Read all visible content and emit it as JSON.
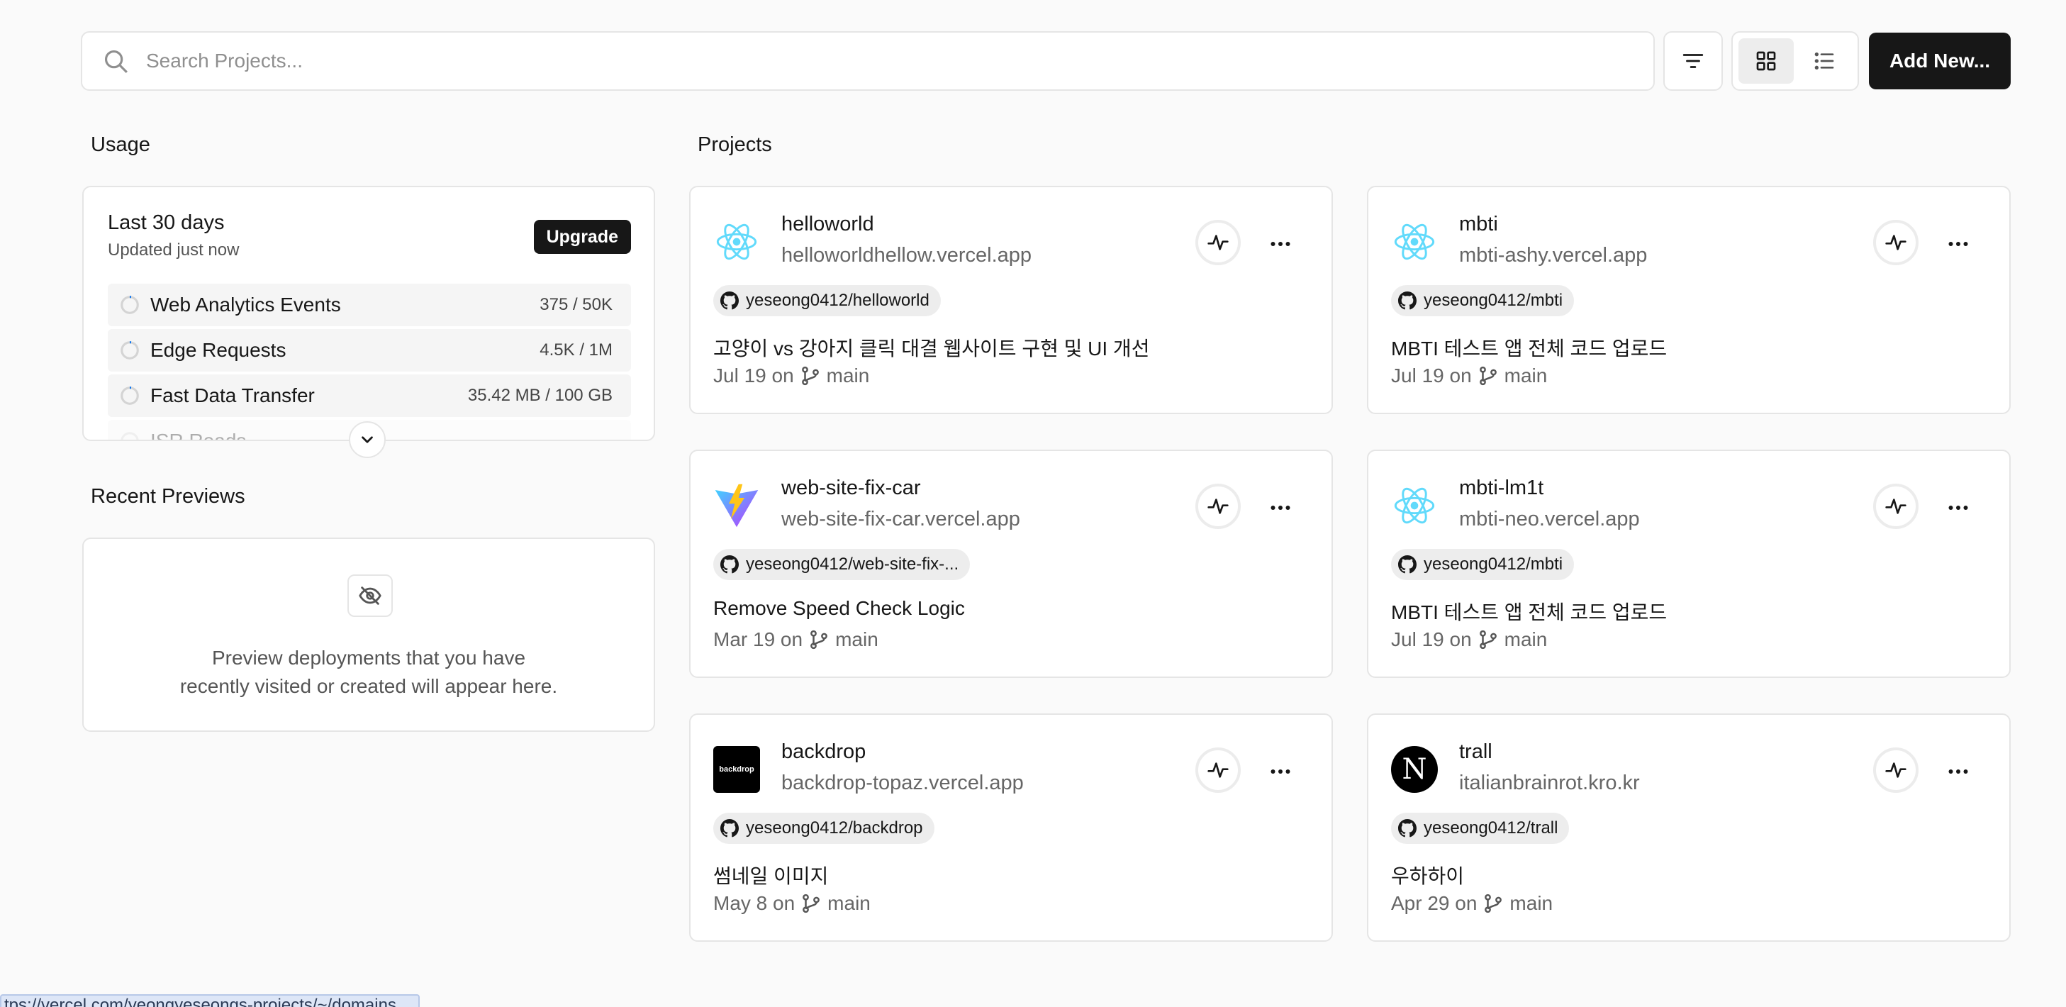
{
  "search": {
    "placeholder": "Search Projects..."
  },
  "toolbar": {
    "add_label": "Add New..."
  },
  "usage": {
    "title": "Usage",
    "period": "Last 30 days",
    "updated": "Updated just now",
    "upgrade_label": "Upgrade",
    "items": [
      {
        "name": "Web Analytics Events",
        "value": "375 / 50K"
      },
      {
        "name": "Edge Requests",
        "value": "4.5K / 1M"
      },
      {
        "name": "Fast Data Transfer",
        "value": "35.42 MB / 100 GB"
      },
      {
        "name": "ISR Reads",
        "value": ""
      }
    ]
  },
  "previews": {
    "title": "Recent Previews",
    "empty_line1": "Preview deployments that you have",
    "empty_line2": "recently visited or created will appear here."
  },
  "projects": {
    "title": "Projects",
    "items": [
      {
        "name": "helloworld",
        "url": "helloworldhellow.vercel.app",
        "repo": "yeseong0412/helloworld",
        "commit": "고양이 vs 강아지 클릭 대결 웹사이트 구현 및 UI 개선",
        "date": "Jul 19 on",
        "branch": "main",
        "logo": "react-icon"
      },
      {
        "name": "mbti",
        "url": "mbti-ashy.vercel.app",
        "repo": "yeseong0412/mbti",
        "commit": "MBTI 테스트 앱 전체 코드 업로드",
        "date": "Jul 19 on",
        "branch": "main",
        "logo": "react-icon"
      },
      {
        "name": "web-site-fix-car",
        "url": "web-site-fix-car.vercel.app",
        "repo": "yeseong0412/web-site-fix-...",
        "commit": "Remove Speed Check Logic",
        "date": "Mar 19 on",
        "branch": "main",
        "logo": "vite-icon"
      },
      {
        "name": "mbti-lm1t",
        "url": "mbti-neo.vercel.app",
        "repo": "yeseong0412/mbti",
        "commit": "MBTI 테스트 앱 전체 코드 업로드",
        "date": "Jul 19 on",
        "branch": "main",
        "logo": "react-icon"
      },
      {
        "name": "backdrop",
        "url": "backdrop-topaz.vercel.app",
        "repo": "yeseong0412/backdrop",
        "commit": "썸네일 이미지",
        "date": "May 8 on",
        "branch": "main",
        "logo": "backdrop-logo",
        "logo_text": "backdrop"
      },
      {
        "name": "trall",
        "url": "italianbrainrot.kro.kr",
        "repo": "yeseong0412/trall",
        "commit": "우하하이",
        "date": "Apr 29 on",
        "branch": "main",
        "logo": "nextjs-icon",
        "logo_text": "N"
      }
    ]
  },
  "status_url": "tps://vercel.com/yeongyeseongs-projects/~/domains"
}
